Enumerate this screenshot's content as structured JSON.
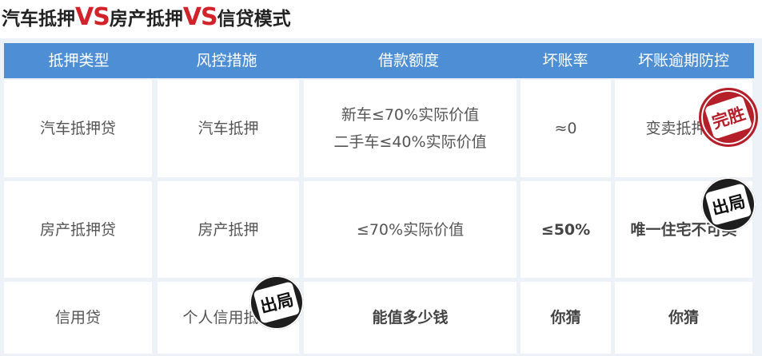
{
  "title": {
    "part1": "汽车抵押",
    "vs1": "VS",
    "part2": "房产抵押",
    "vs2": "VS",
    "part3": "信贷模式"
  },
  "headers": [
    "抵押类型",
    "风控措施",
    "借款额度",
    "坏账率",
    "坏账逾期防控"
  ],
  "rows": [
    {
      "type": "汽车抵押贷",
      "control": "汽车抵押",
      "amount_line1": "新车≤70%实际价值",
      "amount_line2": "二手车≤40%实际价值",
      "bad_rate": "≈0",
      "prevention": "变卖抵押车"
    },
    {
      "type": "房产抵押贷",
      "control": "房产抵押",
      "amount": "≤70%实际价值",
      "bad_rate": "≤50%",
      "prevention": "唯一住宅不可卖"
    },
    {
      "type": "信用贷",
      "control": "个人信用抵押",
      "amount": "能值多少钱",
      "bad_rate": "你猜",
      "prevention": "你猜"
    }
  ],
  "stamps": {
    "win": "完胜",
    "out1": "出局",
    "out2": "出局"
  },
  "colors": {
    "header": "#4e8ed4",
    "accent": "#d2232a",
    "stamp_red": "#b51f2a",
    "background": "#edf1f8"
  }
}
